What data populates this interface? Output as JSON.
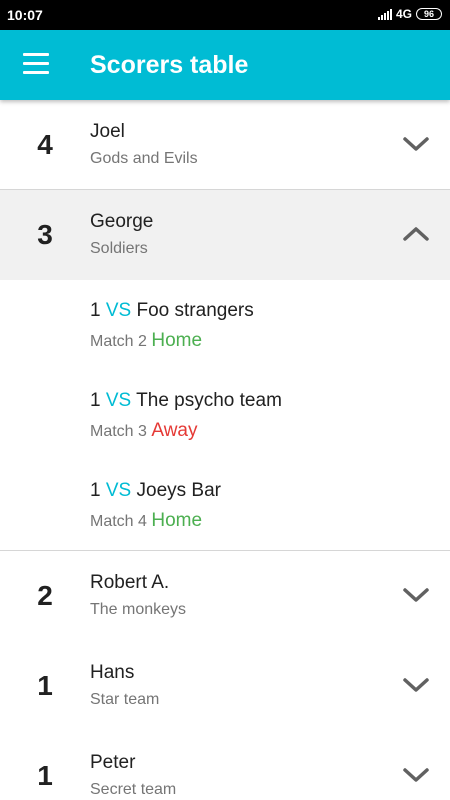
{
  "status_bar": {
    "time": "10:07",
    "network": "4G",
    "battery": "96"
  },
  "app_bar": {
    "title": "Scorers table",
    "menu_icon": "hamburger-menu-icon"
  },
  "colors": {
    "primary": "#00BCD4",
    "home": "#4CAF50",
    "away": "#E53935",
    "expanded_row_bg": "#F1F1F1"
  },
  "scorers": [
    {
      "goals": "4",
      "name": "Joel",
      "team": "Gods and Evils",
      "expanded": false
    },
    {
      "goals": "3",
      "name": "George",
      "team": "Soldiers",
      "expanded": true,
      "matches": [
        {
          "goals": "1",
          "vs": "VS",
          "opponent": "Foo strangers",
          "match": "Match 2",
          "venue": "Home"
        },
        {
          "goals": "1",
          "vs": "VS",
          "opponent": "The psycho team",
          "match": "Match 3",
          "venue": "Away"
        },
        {
          "goals": "1",
          "vs": "VS",
          "opponent": "Joeys Bar",
          "match": "Match 4",
          "venue": "Home"
        }
      ]
    },
    {
      "goals": "2",
      "name": "Robert A.",
      "team": "The monkeys",
      "expanded": false
    },
    {
      "goals": "1",
      "name": "Hans",
      "team": "Star team",
      "expanded": false
    },
    {
      "goals": "1",
      "name": "Peter",
      "team": "Secret team",
      "expanded": false
    }
  ]
}
